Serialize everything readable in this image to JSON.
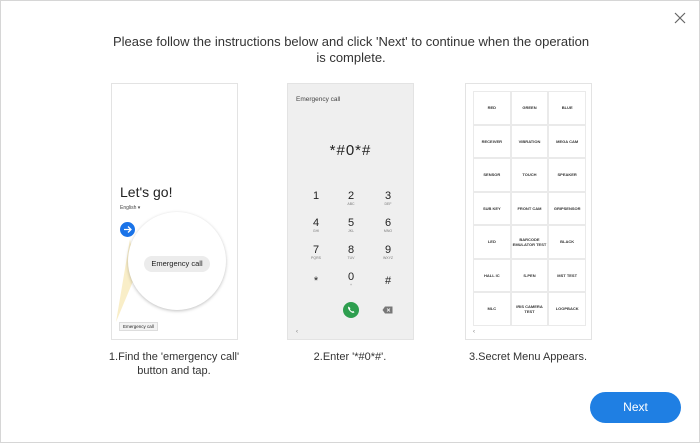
{
  "dialog": {
    "instruction": "Please follow the instructions below and click 'Next' to continue when the operation is complete.",
    "next_label": "Next",
    "close_icon": "close-icon"
  },
  "step1": {
    "caption_line1": "1.Find the 'emergency call'",
    "caption_line2": "button and tap.",
    "lets_go": "Let's go!",
    "language": "English ▾",
    "emergency_pill": "Emergency call",
    "emergency_small": "Emergency call"
  },
  "step2": {
    "caption": "2.Enter '*#0*#'.",
    "screen_title": "Emergency call",
    "code": "*#0*#",
    "keys": [
      "1",
      "2",
      "3",
      "4",
      "5",
      "6",
      "7",
      "8",
      "9",
      "*",
      "0",
      "#"
    ],
    "subs": [
      "",
      "ABC",
      "DEF",
      "GHI",
      "JKL",
      "MNO",
      "PQRS",
      "TUV",
      "WXYZ",
      "",
      "+",
      ""
    ],
    "back": "‹"
  },
  "step3": {
    "caption": "3.Secret Menu Appears.",
    "cells": [
      "RED",
      "GREEN",
      "BLUE",
      "RECEIVER",
      "VIBRATION",
      "MEGA CAM",
      "SENSOR",
      "TOUCH",
      "SPEAKER",
      "SUB KEY",
      "FRONT CAM",
      "GRIPSENSOR",
      "LED",
      "BARCODE EMULATOR TEST",
      "BLACK",
      "HALL IC",
      "S-PEN",
      "MST TEST",
      "MLC",
      "IRIS CAMERA TEST",
      "LOOPBACK"
    ],
    "back": "‹"
  },
  "colors": {
    "accent": "#1f7fe3",
    "call_green": "#2e9e4f"
  }
}
